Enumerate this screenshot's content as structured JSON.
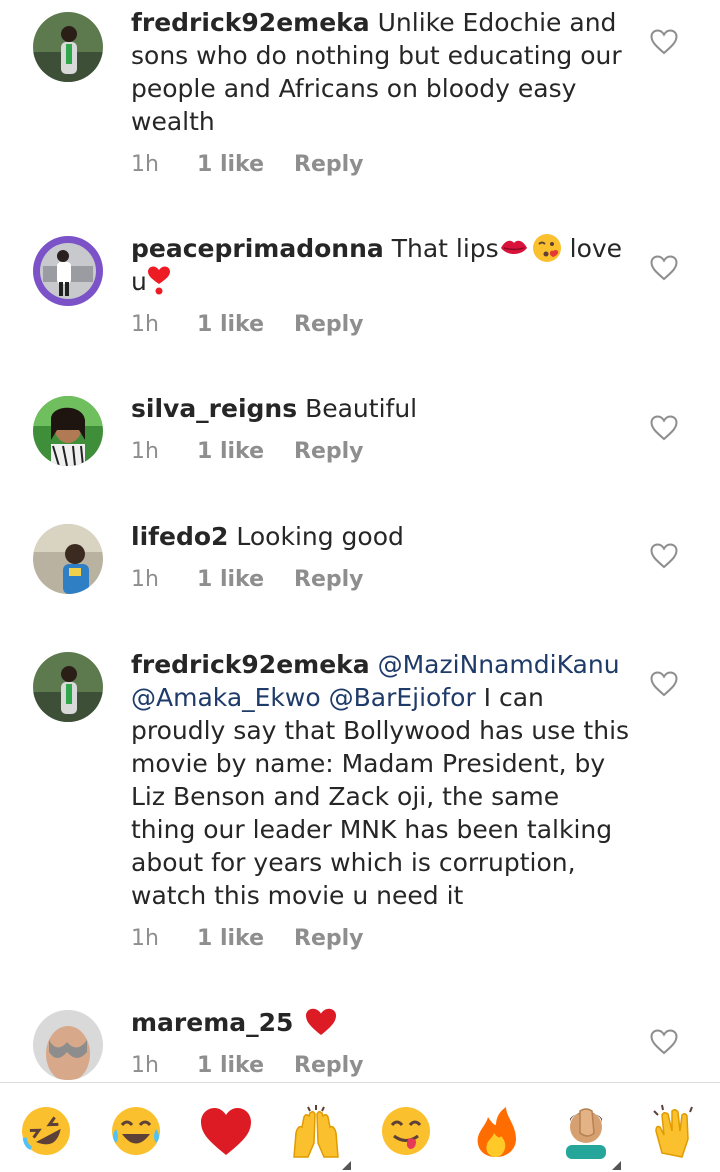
{
  "comments": [
    {
      "username": "fredrick92emeka",
      "text": "Unlike Edochie and sons who do nothing but educating our people and Africans on bloody easy wealth",
      "time": "1h",
      "likes": "1 like",
      "reply": "Reply"
    },
    {
      "username": "peaceprimadonna",
      "text_a": "That lips",
      "text_b": " love u",
      "time": "1h",
      "likes": "1 like",
      "reply": "Reply"
    },
    {
      "username": "silva_reigns",
      "text": "Beautiful",
      "time": "1h",
      "likes": "1 like",
      "reply": "Reply"
    },
    {
      "username": "lifedo2",
      "text": "Looking good",
      "time": "1h",
      "likes": "1 like",
      "reply": "Reply"
    },
    {
      "username": "fredrick92emeka",
      "mentions": [
        "@MaziNnamdiKanu",
        "@Amaka_Ekwo",
        "@BarEjiofor"
      ],
      "text": " I can proudly say that Bollywood has use this movie by name: Madam President, by Liz Benson and Zack oji,  the same thing our leader MNK has been talking about for years which is corruption, watch this movie u need it",
      "time": "1h",
      "likes": "1 like",
      "reply": "Reply"
    },
    {
      "username": "marema_25",
      "text": "",
      "time": "1h",
      "likes": "1 like",
      "reply": "Reply"
    }
  ],
  "emoji_bar": {
    "items": [
      "rofl-emoji",
      "joy-emoji",
      "red-heart-emoji",
      "raised-hands-emoji",
      "yum-emoji",
      "fire-emoji",
      "facepalm-emoji",
      "clapping-hands-emoji"
    ]
  },
  "colors": {
    "text": "#262626",
    "meta": "#8e8e8e",
    "mention": "#1f3b69",
    "heart_red": "#ed1c24"
  }
}
